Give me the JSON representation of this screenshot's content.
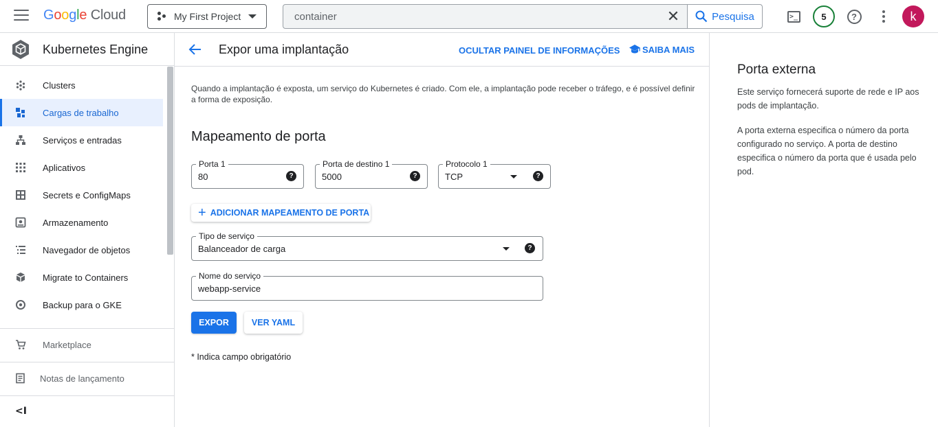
{
  "topbar": {
    "logo": {
      "google": "Google",
      "cloud": "Cloud"
    },
    "project": "My First Project",
    "search": {
      "value": "container",
      "button": "Pesquisa"
    },
    "notifications_count": "5",
    "avatar_letter": "k"
  },
  "sidebar": {
    "product": "Kubernetes Engine",
    "items": [
      {
        "label": "Clusters",
        "icon": "clusters-icon"
      },
      {
        "label": "Cargas de trabalho",
        "icon": "workloads-icon",
        "active": true
      },
      {
        "label": "Serviços e entradas",
        "icon": "services-icon"
      },
      {
        "label": "Aplicativos",
        "icon": "apps-icon"
      },
      {
        "label": "Secrets e ConfigMaps",
        "icon": "secrets-icon"
      },
      {
        "label": "Armazenamento",
        "icon": "storage-icon"
      },
      {
        "label": "Navegador de objetos",
        "icon": "object-browser-icon"
      },
      {
        "label": "Migrate to Containers",
        "icon": "migrate-icon"
      },
      {
        "label": "Backup para o GKE",
        "icon": "backup-icon"
      }
    ],
    "marketplace": "Marketplace",
    "release_notes": "Notas de lançamento",
    "collapse": "<I"
  },
  "main": {
    "title": "Expor uma implantação",
    "hide_panel": "OCULTAR PAINEL DE INFORMAÇÕES",
    "learn_more": "SAIBA MAIS",
    "intro": "Quando a implantação é exposta, um serviço do Kubernetes é criado. Com ele, a implantação pode receber o tráfego, e é possível definir a forma de exposição.",
    "section_title": "Mapeamento de porta",
    "port_label": "Porta 1",
    "port_value": "80",
    "target_port_label": "Porta de destino 1",
    "target_port_value": "5000",
    "protocol_label": "Protocolo 1",
    "protocol_value": "TCP",
    "add_mapping": "ADICIONAR MAPEAMENTO DE PORTA",
    "service_type_label": "Tipo de serviço",
    "service_type_value": "Balanceador de carga",
    "service_name_label": "Nome do serviço",
    "service_name_value": "webapp-service",
    "expose_button": "EXPOR",
    "yaml_button": "VER YAML",
    "required_note": "* Indica campo obrigatório"
  },
  "info_panel": {
    "title": "Porta externa",
    "p1": "Este serviço fornecerá suporte de rede e IP aos pods de implantação.",
    "p2": "A porta externa especifica o número da porta configurado no serviço. A porta de destino especifica o número da porta que é usada pelo pod."
  },
  "colors": {
    "accent": "#1a73e8",
    "active_bg": "#e8f0fe",
    "avatar": "#c2185b",
    "notif_ring": "#188038"
  }
}
